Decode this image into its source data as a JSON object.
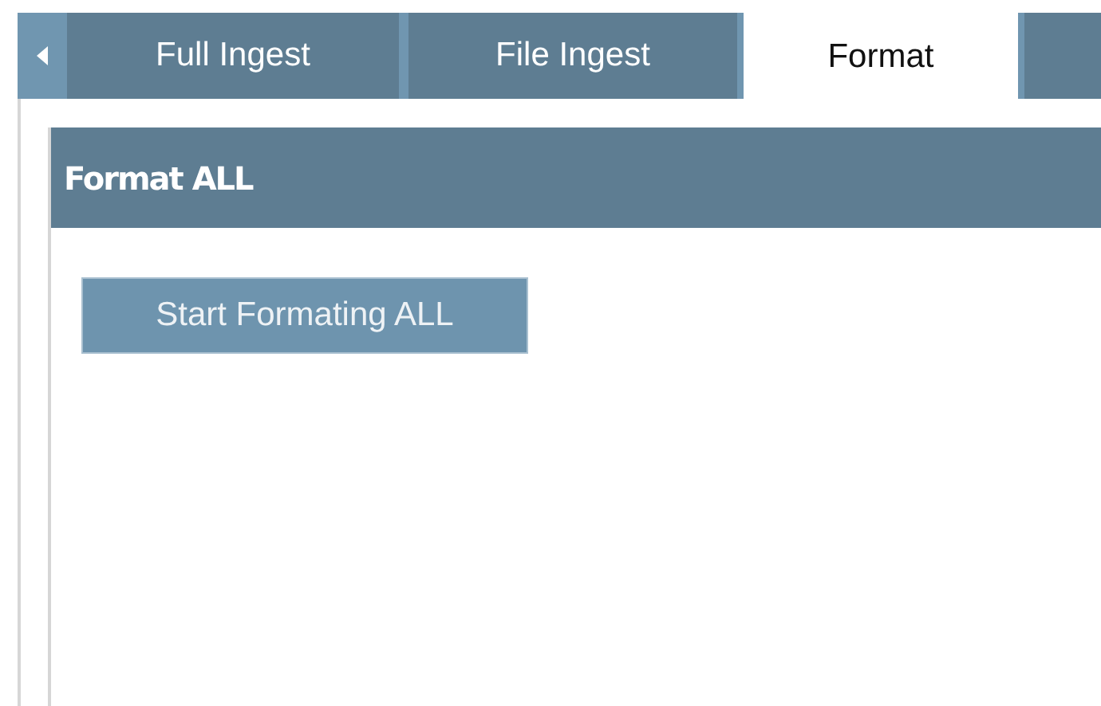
{
  "tabs": [
    {
      "label": "Full Ingest",
      "selected": false
    },
    {
      "label": "File Ingest",
      "selected": false
    },
    {
      "label": "Format",
      "selected": true
    },
    {
      "selected": false
    }
  ],
  "panel": {
    "title": "Format ALL",
    "button": "Start Formating ALL"
  }
}
